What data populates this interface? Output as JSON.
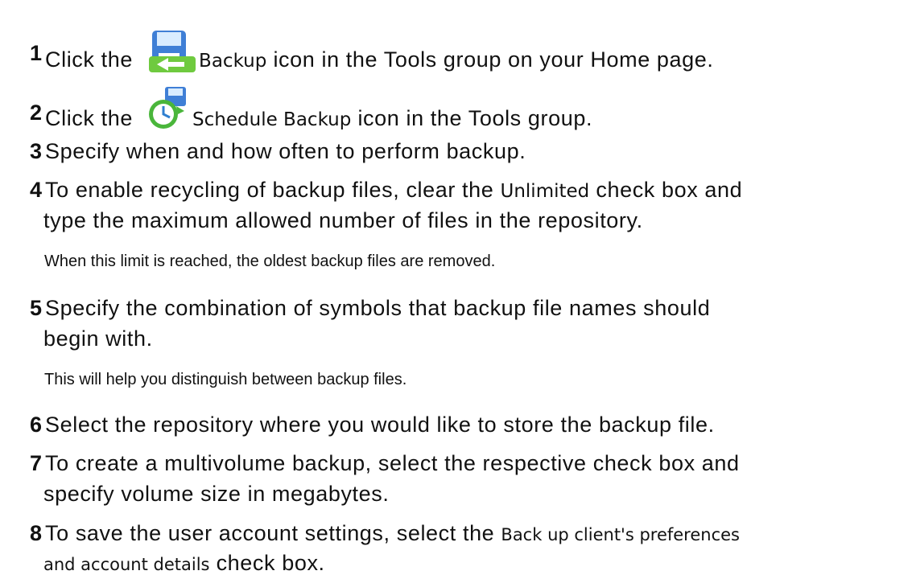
{
  "steps": [
    {
      "num": "1",
      "pre": "Click the",
      "ui": "Backup",
      "post": " icon in the Tools group on your Home page."
    },
    {
      "num": "2",
      "pre": "Click the",
      "ui": "Schedule Backup",
      "post": " icon in the Tools group."
    },
    {
      "num": "3",
      "text": "Specify when and how often to perform backup."
    },
    {
      "num": "4",
      "pre": "To enable recycling of backup files, clear the ",
      "ui": "Unlimited",
      "post": " check box and",
      "line2": "type the maximum allowed number of files in the repository.",
      "note": "When this limit is reached, the oldest backup files are removed."
    },
    {
      "num": "5",
      "text": "Specify the combination of symbols that backup file names should",
      "line2": "begin with.",
      "note": "This will help you distinguish between backup files."
    },
    {
      "num": "6",
      "text": "Select the repository where you would like to store the backup file."
    },
    {
      "num": "7",
      "text": "To create a multivolume backup, select the respective check box and",
      "line2": "specify volume size in megabytes."
    },
    {
      "num": "8",
      "pre": "To save the user account settings, select the ",
      "ui": "Back up client's preferences",
      "line2ui": "and account details",
      "line2post": " check box."
    }
  ],
  "icons": {
    "step1": "backup-icon",
    "step2": "schedule-backup-icon"
  }
}
